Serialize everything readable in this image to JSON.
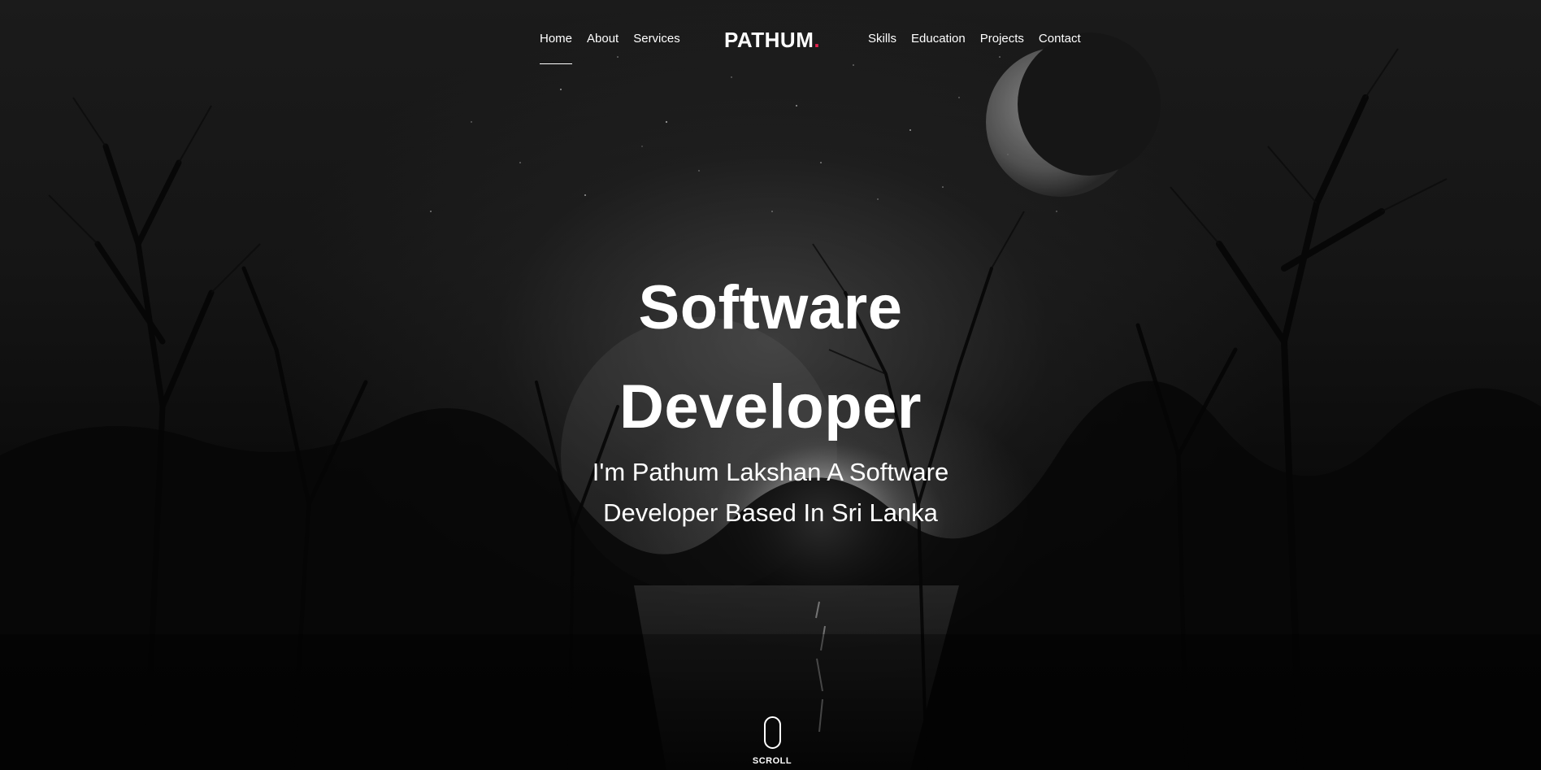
{
  "nav": {
    "left_items": [
      {
        "label": "Home",
        "active": true
      },
      {
        "label": "About",
        "active": false
      },
      {
        "label": "Services",
        "active": false
      }
    ],
    "right_items": [
      {
        "label": "Skills",
        "active": false
      },
      {
        "label": "Education",
        "active": false
      },
      {
        "label": "Projects",
        "active": false
      },
      {
        "label": "Contact",
        "active": false
      }
    ],
    "logo": {
      "text": "PATHUM",
      "dot": "."
    }
  },
  "hero": {
    "headline_line1": "Software",
    "headline_line2": "Developer",
    "subtitle_line1": "I'm Pathum Lakshan A Software",
    "subtitle_line2": "Developer Based In Sri Lanka"
  },
  "scroll": {
    "label": "SCROLL",
    "icon": "mouse-icon"
  },
  "colors": {
    "accent": "#e8224f",
    "text": "#ffffff",
    "background": "#050505"
  }
}
